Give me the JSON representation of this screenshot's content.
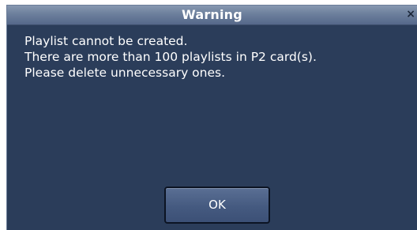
{
  "dialog": {
    "title": "Warning",
    "close_glyph": "×",
    "close_icon": "close-icon",
    "message_lines": [
      "Playlist cannot be created.",
      "There are more than 100 playlists in P2 card(s).",
      "Please delete unnecessary ones."
    ],
    "ok_label": "OK"
  },
  "colors": {
    "dialog_background": "#2b3d5a",
    "titlebar": "#6c7f9c",
    "text": "#ffffff",
    "button": "#4a5f85"
  }
}
